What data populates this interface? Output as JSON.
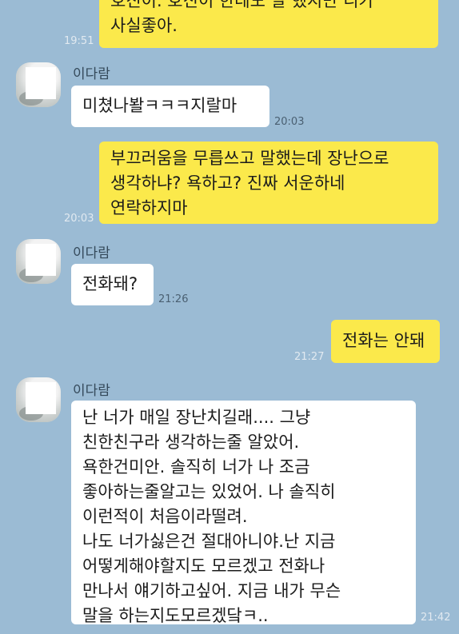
{
  "colors": {
    "background": "#9bbbd4",
    "my_bubble": "#fbe94b",
    "their_bubble": "#ffffff"
  },
  "messages": [
    {
      "sender": "me",
      "text": "호진이. 호진이 한테도 말 했지만 니가\n사실좋아.",
      "time": "19:51"
    },
    {
      "sender": "them",
      "name": "이다람",
      "text": "미쳤나봘ㅋㅋㅋ지랄마",
      "time": "20:03"
    },
    {
      "sender": "me",
      "text": "부끄러움을 무릅쓰고 말했는데 장난으로\n생각하냐? 욕하고? 진짜 서운하네\n연락하지마",
      "time": "20:03"
    },
    {
      "sender": "them",
      "name": "이다람",
      "text": "전화돼?",
      "time": "21:26"
    },
    {
      "sender": "me",
      "text": "전화는 안돼",
      "time": "21:27"
    },
    {
      "sender": "them",
      "name": "이다람",
      "text": "난 너가 매일 장난치길래.... 그냥\n친한친구라 생각하는줄 알았어.\n욕한건미안. 솔직히 너가 나 조금\n좋아하는줄알고는 있었어. 나 솔직히\n이런적이 처음이라떨려.\n나도 너가싫은건 절대아니야.난 지금\n어떻게해야할지도 모르겠고 전화나\n만나서 얘기하고싶어. 지금 내가 무슨\n말을 하는지도모르겠닼ㅋ..",
      "time": "21:42"
    }
  ]
}
